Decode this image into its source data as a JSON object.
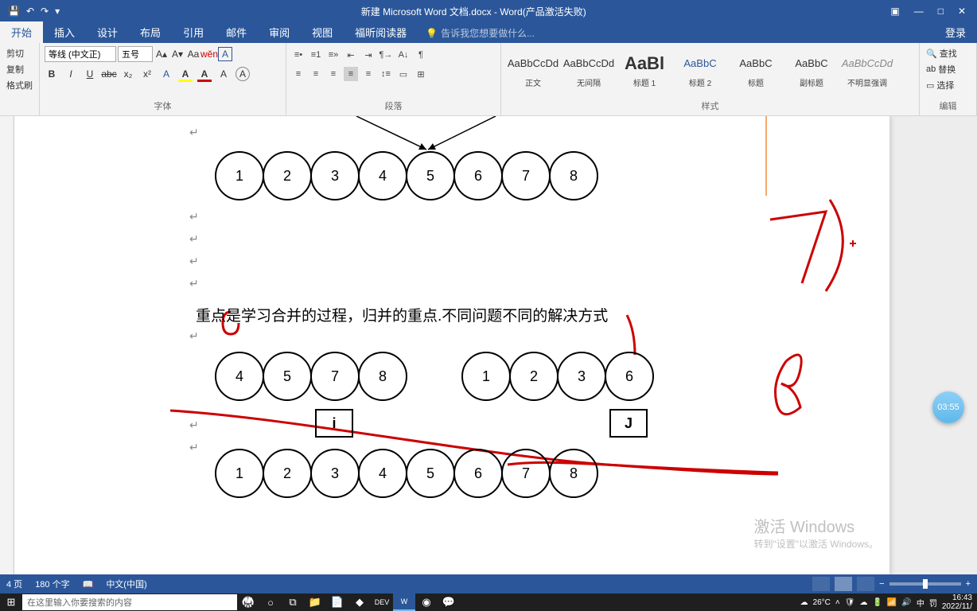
{
  "titlebar": {
    "title": "新建 Microsoft Word 文档.docx - Word(产品激活失败)"
  },
  "tabs": {
    "file": "开始",
    "items": [
      "插入",
      "设计",
      "布局",
      "引用",
      "邮件",
      "审阅",
      "视图",
      "福昕阅读器"
    ],
    "tellme": "告诉我您想要做什么...",
    "login": "登录"
  },
  "clipboard": {
    "cut": "剪切",
    "copy": "复制",
    "fmt": "格式刷"
  },
  "font": {
    "label": "字体",
    "name": "等线 (中文正)",
    "size": "五号",
    "btns": {
      "b": "B",
      "i": "I",
      "u": "U",
      "abc": "abc",
      "x2": "x₂",
      "x2sup": "x²",
      "aa": "Aa",
      "A": "A",
      "highlightA": "A",
      "colorA": "A",
      "boxA": "A",
      "circleA": "A"
    }
  },
  "para": {
    "label": "段落"
  },
  "styles": {
    "label": "样式",
    "items": [
      {
        "preview": "AaBbCcDd",
        "name": "正文",
        "cls": ""
      },
      {
        "preview": "AaBbCcDd",
        "name": "无间隔",
        "cls": ""
      },
      {
        "preview": "AaBl",
        "name": "标题 1",
        "cls": "big"
      },
      {
        "preview": "AaBbC",
        "name": "标题 2",
        "cls": "blue"
      },
      {
        "preview": "AaBbC",
        "name": "标题",
        "cls": ""
      },
      {
        "preview": "AaBbC",
        "name": "副标题",
        "cls": ""
      },
      {
        "preview": "AaBbCcDd",
        "name": "不明显强调",
        "cls": "gray"
      }
    ]
  },
  "editing": {
    "label": "编辑",
    "find": "查找",
    "replace": "替换",
    "select": "选择"
  },
  "doc": {
    "row1": [
      "1",
      "2",
      "3",
      "4",
      "5",
      "6",
      "7",
      "8"
    ],
    "text": "重点是学习合并的过程，归并的重点.不同问题不同的解决方式",
    "row2a": [
      "4",
      "5",
      "7",
      "8"
    ],
    "row2b": [
      "1",
      "2",
      "3",
      "6"
    ],
    "i": "i",
    "j": "J",
    "row3": [
      "1",
      "2",
      "3",
      "4",
      "5",
      "6",
      "7",
      "8"
    ]
  },
  "watermark": {
    "title": "激活 Windows",
    "sub": "转到\"设置\"以激活 Windows。"
  },
  "timer": "03:55",
  "status": {
    "page": "4 页",
    "words": "180 个字",
    "lang": "中文(中国)"
  },
  "taskbar": {
    "search": "在这里输入你要搜索的内容",
    "temp": "26°C",
    "ime": "中",
    "ime2": "罚",
    "time": "16:43",
    "date": "2022/11/"
  }
}
